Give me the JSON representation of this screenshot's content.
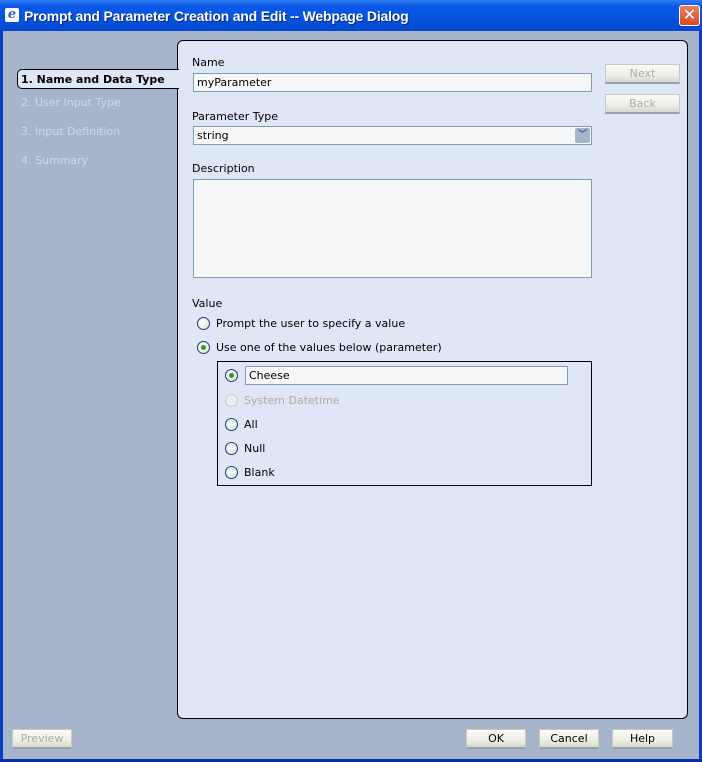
{
  "window": {
    "title": "Prompt and Parameter Creation and Edit -- Webpage Dialog",
    "close_icon": "close-x-icon",
    "app_icon": "internet-explorer-icon"
  },
  "steps": [
    {
      "label": "1. Name and Data Type",
      "active": true
    },
    {
      "label": "2. User Input Type",
      "active": false
    },
    {
      "label": "3. Input Definition",
      "active": false
    },
    {
      "label": "4. Summary",
      "active": false
    }
  ],
  "form": {
    "name_label": "Name",
    "name_value": "myParameter",
    "type_label": "Parameter Type",
    "type_value": "string",
    "description_label": "Description",
    "description_value": "",
    "value_label": "Value",
    "value_options": [
      {
        "label": "Prompt the user to specify a value",
        "checked": false
      },
      {
        "label": "Use one of the values below (parameter)",
        "checked": true
      }
    ],
    "sub_options": {
      "custom_value": "Cheese",
      "custom_checked": true,
      "items": [
        {
          "label": "System Datetime",
          "disabled": true
        },
        {
          "label": "All",
          "disabled": false
        },
        {
          "label": "Null",
          "disabled": false
        },
        {
          "label": "Blank",
          "disabled": false
        }
      ]
    }
  },
  "nav_buttons": {
    "next": "Next",
    "back": "Back"
  },
  "footer": {
    "preview": "Preview",
    "ok": "OK",
    "cancel": "Cancel",
    "help": "Help"
  }
}
